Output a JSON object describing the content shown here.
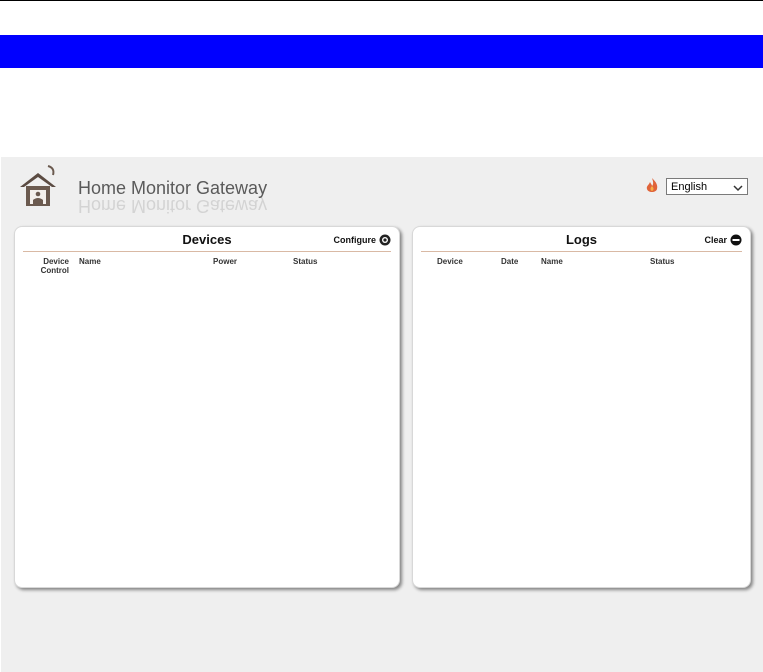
{
  "header": {
    "title": "Home Monitor Gateway",
    "language": {
      "selected": "English"
    }
  },
  "devices_panel": {
    "title": "Devices",
    "action_label": "Configure",
    "columns": [
      "Device Control",
      "Name",
      "Power",
      "Status"
    ]
  },
  "logs_panel": {
    "title": "Logs",
    "action_label": "Clear",
    "columns": [
      "Device",
      "Date",
      "Name",
      "Status"
    ]
  },
  "colors": {
    "banner": "#0000ff",
    "background": "#efefef",
    "rule": "#d9b9a4"
  },
  "icons": [
    "home-icon",
    "fire-icon",
    "chevron-down-icon",
    "gear-icon",
    "clear-icon"
  ]
}
